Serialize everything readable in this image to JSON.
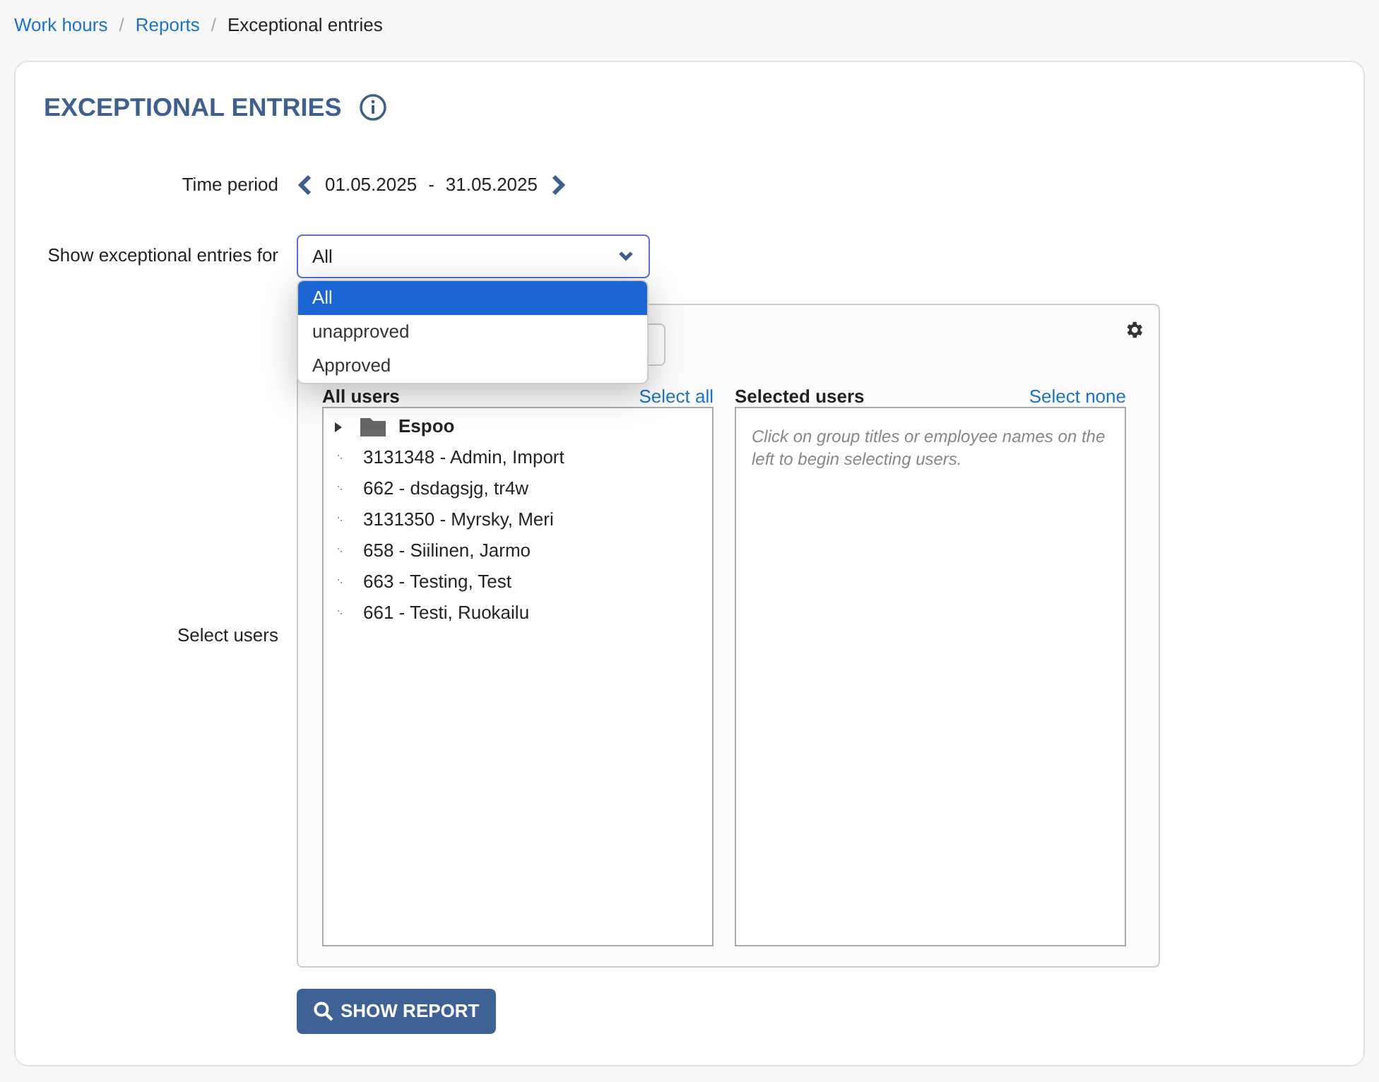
{
  "breadcrumbs": [
    {
      "label": "Work hours",
      "kind": "link"
    },
    {
      "separator": "/",
      "label": "Reports",
      "kind": "link"
    },
    {
      "separator": "/",
      "label": "Exceptional entries",
      "kind": "current"
    }
  ],
  "title": "EXCEPTIONAL ENTRIES",
  "time_period": {
    "label": "Time period",
    "start": "01.05.2025",
    "separator": "-",
    "end": "31.05.2025"
  },
  "entries_for": {
    "label": "Show exceptional entries for",
    "value": "All",
    "expanded": true,
    "options": [
      {
        "label": "All",
        "selected": true
      },
      {
        "label": "unapproved",
        "selected": false
      },
      {
        "label": "Approved",
        "selected": false
      }
    ]
  },
  "select_users": {
    "label": "Select users",
    "all_users": {
      "title": "All users",
      "link": "Select all",
      "items": [
        {
          "label": "Espoo",
          "kind": "group",
          "expanded": false
        },
        {
          "label": "3131348 - Admin, Import",
          "kind": "user"
        },
        {
          "label": "662 - dsdagsjg, tr4w",
          "kind": "user"
        },
        {
          "label": "3131350 - Myrsky, Meri",
          "kind": "user"
        },
        {
          "label": "658 - Siilinen, Jarmo",
          "kind": "user"
        },
        {
          "label": "663 - Testing, Test",
          "kind": "user"
        },
        {
          "label": "661 - Testi, Ruokailu",
          "kind": "user"
        }
      ]
    },
    "selected_users": {
      "title": "Selected users",
      "link": "Select none",
      "hint": "Click on group titles or employee names on the left to begin selecting users."
    }
  },
  "button": "SHOW REPORT"
}
